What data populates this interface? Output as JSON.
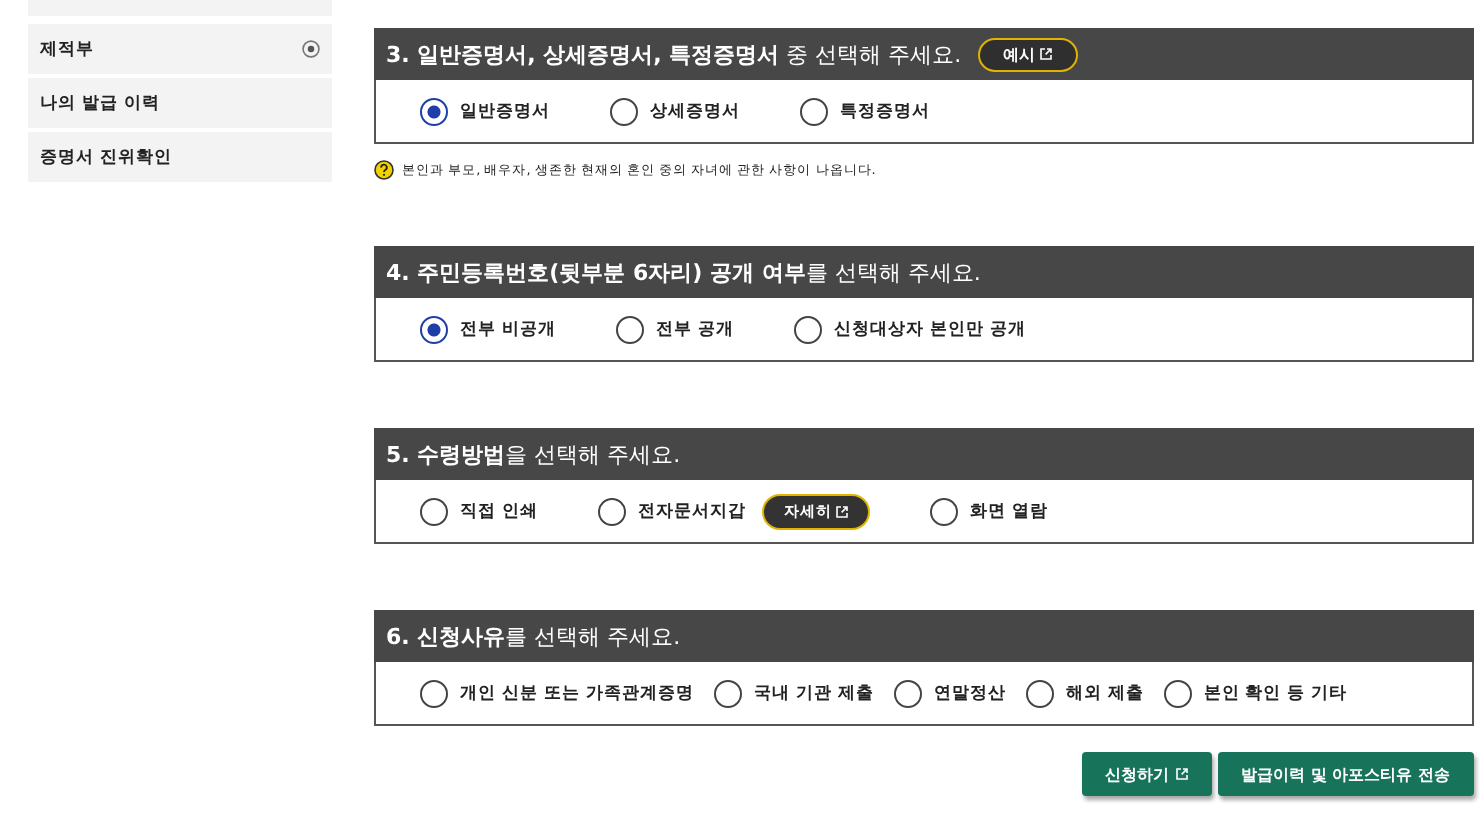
{
  "sidebar": {
    "items": [
      {
        "label": "제적부",
        "expandable": true
      },
      {
        "label": "나의 발급 이력",
        "expandable": false
      },
      {
        "label": "증명서 진위확인",
        "expandable": false
      }
    ]
  },
  "sections": [
    {
      "title": "**3. 일반증명서, 상세증명서, 특정증명서** 중 선택해 주세요.",
      "header_button": "예시",
      "note": "본인과 부모, 배우자, 생존한 현재의 혼인 중의 자녀에 관한 사항이 나옵니다.",
      "options": [
        {
          "label": "일반증명서",
          "selected": true
        },
        {
          "label": "상세증명서",
          "selected": false
        },
        {
          "label": "특정증명서",
          "selected": false
        }
      ]
    },
    {
      "title": "**4. 주민등록번호(뒷부분 6자리) 공개 여부**를 선택해 주세요.",
      "options": [
        {
          "label": "전부 비공개",
          "selected": true
        },
        {
          "label": "전부 공개",
          "selected": false
        },
        {
          "label": "신청대상자 본인만 공개",
          "selected": false
        }
      ]
    },
    {
      "title": "**5. 수령방법**을 선택해 주세요.",
      "options": [
        {
          "label": "직접 인쇄",
          "selected": false
        },
        {
          "label": "전자문서지갑",
          "selected": false,
          "detail_button": "자세히"
        },
        {
          "label": "화면 열람",
          "selected": false
        }
      ]
    },
    {
      "title": "**6. 신청사유**를 선택해 주세요.",
      "options": [
        {
          "label": "개인 신분 또는 가족관계증명",
          "selected": false
        },
        {
          "label": "국내 기관 제출",
          "selected": false
        },
        {
          "label": "연말정산",
          "selected": false
        },
        {
          "label": "해외 제출",
          "selected": false
        },
        {
          "label": "본인 확인 등 기타",
          "selected": false
        }
      ]
    }
  ],
  "actions": [
    {
      "label": "신청하기",
      "external": true
    },
    {
      "label": "발급이력 및 아포스티유 전송",
      "external": false
    }
  ]
}
